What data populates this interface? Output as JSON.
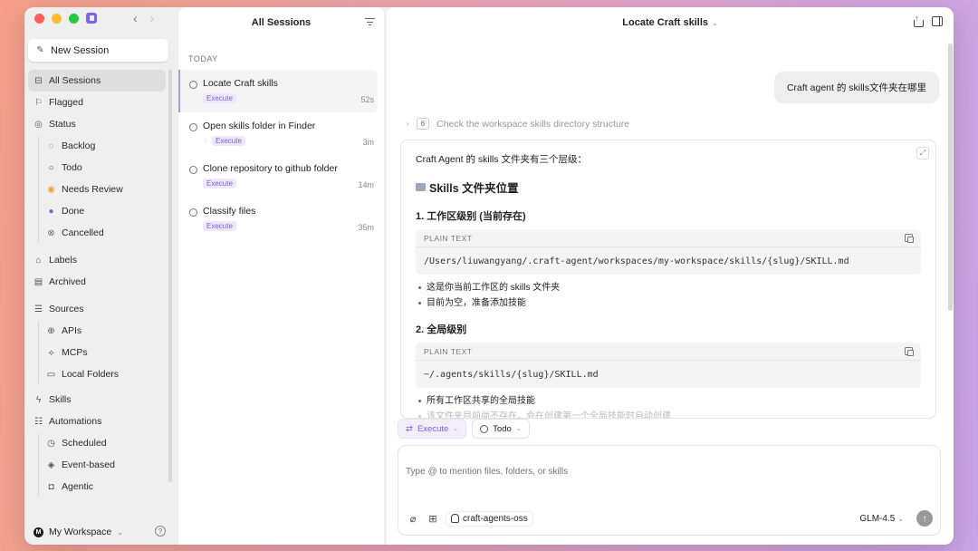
{
  "sidebar": {
    "new_session_label": "New Session",
    "items": [
      {
        "key": "all",
        "label": "All Sessions",
        "icon": "inbox-icon"
      },
      {
        "key": "flagged",
        "label": "Flagged",
        "icon": "flag-icon"
      },
      {
        "key": "status",
        "label": "Status",
        "icon": "status-check-icon"
      }
    ],
    "status_items": [
      {
        "label": "Backlog",
        "icon": "dashed-circle-icon"
      },
      {
        "label": "Todo",
        "icon": "circle-icon"
      },
      {
        "label": "Needs Review",
        "icon": "review-circle-icon",
        "color": "#f0a13a"
      },
      {
        "label": "Done",
        "icon": "check-circle-icon",
        "color": "#7a63e0"
      },
      {
        "label": "Cancelled",
        "icon": "cancelled-circle-icon"
      }
    ],
    "labels_label": "Labels",
    "archived_label": "Archived",
    "sources_label": "Sources",
    "sources_items": [
      {
        "label": "APIs",
        "icon": "globe-icon"
      },
      {
        "label": "MCPs",
        "icon": "mcp-icon"
      },
      {
        "label": "Local Folders",
        "icon": "folder-icon"
      }
    ],
    "skills_label": "Skills",
    "automations_label": "Automations",
    "automation_items": [
      {
        "label": "Scheduled",
        "icon": "clock-icon"
      },
      {
        "label": "Event-based",
        "icon": "signal-icon"
      },
      {
        "label": "Agentic",
        "icon": "robot-icon"
      }
    ],
    "workspace_label": "My Workspace",
    "workspace_initial": "M"
  },
  "sessions": {
    "title": "All Sessions",
    "group_label": "TODAY",
    "items": [
      {
        "title": "Locate Craft skills",
        "badge": "Execute",
        "time": "52s"
      },
      {
        "title": "Open skills folder in Finder",
        "badge": "Execute",
        "time": "3m"
      },
      {
        "title": "Clone repository to github folder",
        "badge": "Execute",
        "time": "14m"
      },
      {
        "title": "Classify files",
        "badge": "Execute",
        "time": "35m"
      }
    ]
  },
  "main": {
    "title": "Locate Craft skills",
    "user_message": "Craft agent 的 skills文件夹在哪里",
    "steps_count": "6",
    "steps_label": "Check the workspace skills directory structure",
    "answer": {
      "intro": "Craft Agent 的 skills 文件夹有三个层级：",
      "heading": "Skills 文件夹位置",
      "section1_title": "1. 工作区级别 (当前存在)",
      "code1_label": "PLAIN TEXT",
      "code1_body": "/Users/liuwangyang/.craft-agent/workspaces/my-workspace/skills/{slug}/SKILL.md",
      "section1_bullets": [
        "这是你当前工作区的 skills 文件夹",
        "目前为空，准备添加技能"
      ],
      "section2_title": "2. 全局级别",
      "code2_label": "PLAIN TEXT",
      "code2_body": "~/.agents/skills/{slug}/SKILL.md",
      "section2_bullets": [
        "所有工作区共享的全局技能",
        "该文件夹目前尚不存在，会在创建第一个全局技能时自动创建"
      ]
    },
    "mode_chip": "Execute",
    "status_chip": "Todo",
    "composer_placeholder": "Type @ to mention files, folders, or skills",
    "repo_label": "craft-agents-oss",
    "model_label": "GLM-4.5"
  }
}
